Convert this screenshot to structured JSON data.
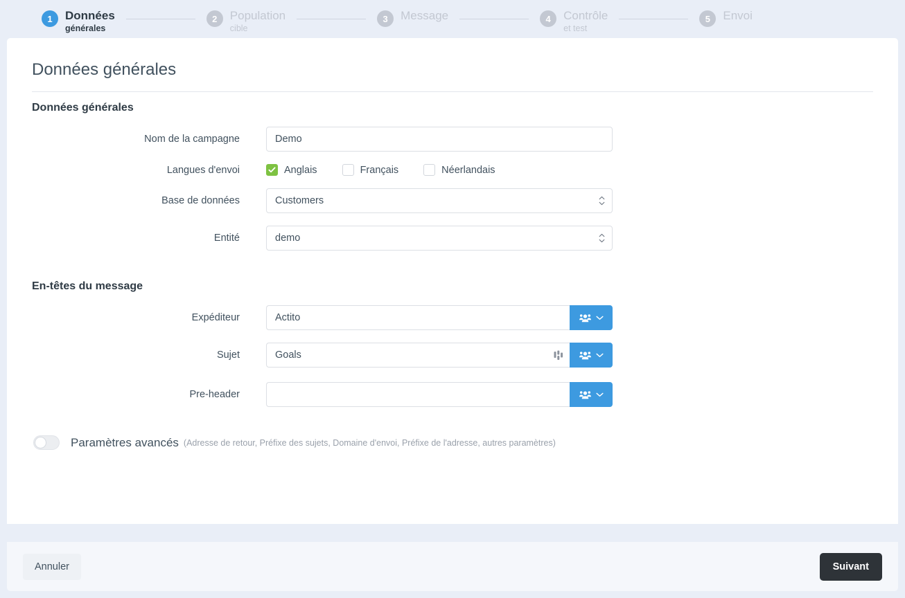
{
  "stepper": {
    "steps": [
      {
        "number": "1",
        "title": "Données",
        "subtitle": "générales",
        "state": "active"
      },
      {
        "number": "2",
        "title": "Population",
        "subtitle": "cible",
        "state": "inactive"
      },
      {
        "number": "3",
        "title": "Message",
        "subtitle": "",
        "state": "inactive"
      },
      {
        "number": "4",
        "title": "Contrôle",
        "subtitle": "et test",
        "state": "inactive"
      },
      {
        "number": "5",
        "title": "Envoi",
        "subtitle": "",
        "state": "inactive"
      }
    ]
  },
  "page": {
    "title": "Données générales",
    "section_general": "Données générales",
    "section_headers": "En-têtes du message"
  },
  "fields": {
    "campaign_name": {
      "label": "Nom de la campagne",
      "value": "Demo",
      "placeholder": ""
    },
    "languages": {
      "label": "Langues d'envoi",
      "options": [
        {
          "label": "Anglais",
          "checked": true
        },
        {
          "label": "Français",
          "checked": false
        },
        {
          "label": "Néerlandais",
          "checked": false
        }
      ]
    },
    "database": {
      "label": "Base de données",
      "value": "Customers",
      "options": [
        "Customers"
      ]
    },
    "entity": {
      "label": "Entité",
      "value": "demo",
      "options": [
        "demo"
      ]
    },
    "sender": {
      "label": "Expéditeur",
      "value": "Actito",
      "placeholder": ""
    },
    "subject": {
      "label": "Sujet",
      "value": "Goals",
      "placeholder": ""
    },
    "preheader": {
      "label": "Pre-header",
      "value": "",
      "placeholder": ""
    }
  },
  "advanced": {
    "label": "Paramètres avancés",
    "hint": "(Adresse de retour, Préfixe des sujets, Domaine d'envoi, Préfixe de l'adresse, autres paramètres)",
    "enabled": false
  },
  "footer": {
    "cancel_label": "Annuler",
    "next_label": "Suivant"
  },
  "colors": {
    "accent_blue": "#3d9ae0",
    "checkbox_green": "#7ec242",
    "next_button": "#2e3338",
    "page_background": "#e9eef7"
  }
}
